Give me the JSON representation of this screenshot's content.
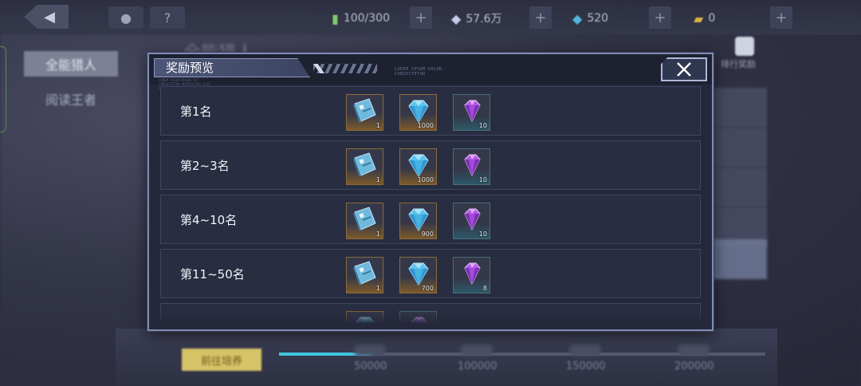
{
  "topbar": {
    "back_icon": "back-arrow-icon",
    "help_label": "?",
    "stamina": "100/300",
    "crystal": "57.6万",
    "diamond": "520",
    "ticket": "0",
    "plus": "+"
  },
  "sidebar": {
    "items": [
      {
        "label": "全能猎人"
      },
      {
        "label": "阅读王者"
      }
    ]
  },
  "background": {
    "title": "全能猎人",
    "right_label": "排行奖励",
    "gold_button": "前往培养",
    "milestones": [
      "50000",
      "100000",
      "150000",
      "200000"
    ],
    "progress_fraction": 0.19
  },
  "dialog": {
    "title": "奖励预览",
    "deco_text": "LOREM IPSUM DOLOR\nCONSECTETUR",
    "deco_text_left": "LOREM IPSUM DOLOR SIT\nCONSECTETUR ADIPISCING ELIT\nLOREM IPSUM DOLOR",
    "rows": [
      {
        "rank": "第1名",
        "items": [
          {
            "icon": "ticket-card-icon",
            "qty": "1"
          },
          {
            "icon": "blue-diamond-icon",
            "qty": "1000"
          },
          {
            "icon": "purple-gem-icon",
            "qty": "10"
          }
        ]
      },
      {
        "rank": "第2~3名",
        "items": [
          {
            "icon": "ticket-card-icon",
            "qty": "1"
          },
          {
            "icon": "blue-diamond-icon",
            "qty": "1000"
          },
          {
            "icon": "purple-gem-icon",
            "qty": "10"
          }
        ]
      },
      {
        "rank": "第4~10名",
        "items": [
          {
            "icon": "ticket-card-icon",
            "qty": "1"
          },
          {
            "icon": "blue-diamond-icon",
            "qty": "900"
          },
          {
            "icon": "purple-gem-icon",
            "qty": "10"
          }
        ]
      },
      {
        "rank": "第11~50名",
        "items": [
          {
            "icon": "ticket-card-icon",
            "qty": "1"
          },
          {
            "icon": "blue-diamond-icon",
            "qty": "700"
          },
          {
            "icon": "purple-gem-icon",
            "qty": "8"
          }
        ]
      },
      {
        "rank": "",
        "items": [
          {
            "icon": "blue-diamond-icon",
            "qty": ""
          },
          {
            "icon": "purple-gem-icon",
            "qty": ""
          }
        ]
      }
    ]
  },
  "colors": {
    "dialog_bg": "#24283a",
    "row_bg": "#282d41",
    "accent_blue": "#43c6e0",
    "gold": "#d7c468"
  }
}
